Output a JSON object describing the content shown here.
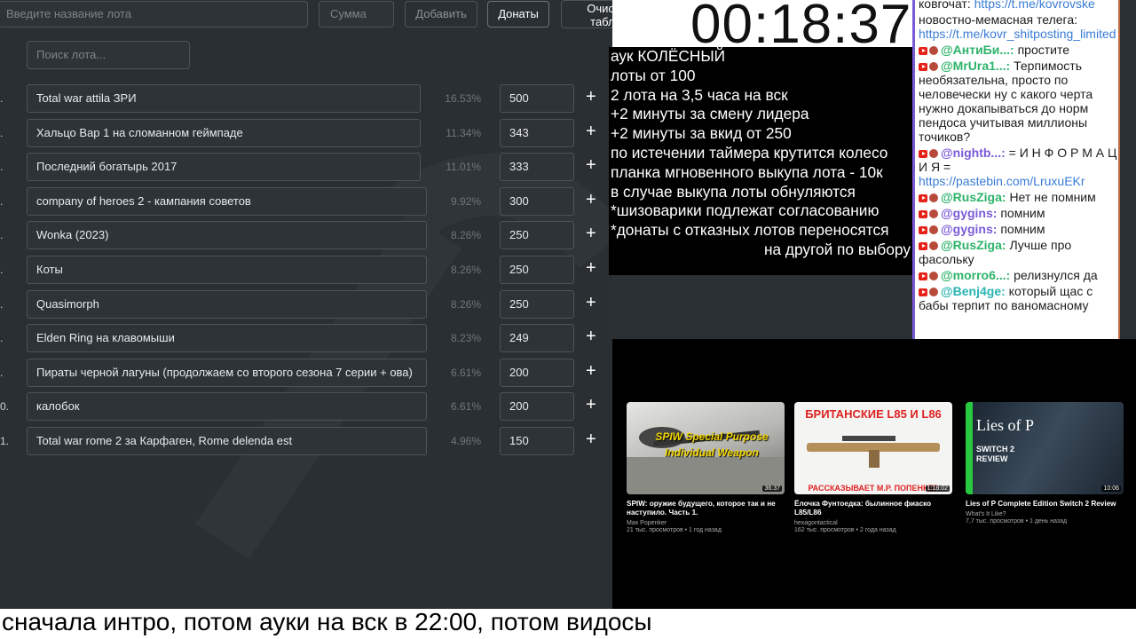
{
  "auction": {
    "lot_name_placeholder": "Введите название лота",
    "amount_placeholder": "Сумма",
    "add_label": "Добавить",
    "donations_label": "Донаты",
    "clear_label_line1": "Очистить",
    "clear_label_line2": "таблицу",
    "search_placeholder": "Поиск лота...",
    "lots": [
      {
        "num": ".",
        "name": "Total war attila ЗРИ",
        "percent": "16.53%",
        "amount": "500"
      },
      {
        "num": ".",
        "name": "Хальцо Вар 1 на сломанном геймпаде",
        "percent": "11.34%",
        "amount": "343"
      },
      {
        "num": ".",
        "name": "Последний богатырь 2017",
        "percent": "11.01%",
        "amount": "333"
      },
      {
        "num": ".",
        "name": "company of heroes 2 - кампания советов",
        "percent": "9.92%",
        "amount": "300"
      },
      {
        "num": ".",
        "name": "Wonka (2023)",
        "percent": "8.26%",
        "amount": "250"
      },
      {
        "num": ".",
        "name": "Коты",
        "percent": "8.26%",
        "amount": "250"
      },
      {
        "num": ".",
        "name": "Quasimorph",
        "percent": "8.26%",
        "amount": "250"
      },
      {
        "num": ".",
        "name": "Elden Ring на клавомыши",
        "percent": "8.23%",
        "amount": "249"
      },
      {
        "num": ".",
        "name": "Пираты черной лагуны (продолжаем со второго сезона 7 серии + ова)",
        "percent": "6.61%",
        "amount": "200"
      },
      {
        "num": "0.",
        "name": "калобок",
        "percent": "6.61%",
        "amount": "200"
      },
      {
        "num": "1.",
        "name": "Total war rome 2 за Карфаген, Rome delenda est",
        "percent": "4.96%",
        "amount": "150"
      }
    ]
  },
  "timer": {
    "value": "00:18:37"
  },
  "rules": [
    "аук КОЛЁСНЫЙ",
    "лоты от 100",
    "2 лота на 3,5 часа на вск",
    "+2 минуты за смену лидера",
    "+2 минуты за вкид от 250",
    "по истечении таймера крутится колесо",
    "планка мгновенного выкупа лота - 10к",
    "в случае выкупа лоты обнуляются",
    "*шизоварики подлежат согласованию",
    "*донаты с отказных лотов переносятся",
    "на другой по выбору"
  ],
  "chat": {
    "intro_text": "ковrочат: ",
    "intro_link": "https://t.me/kovrovske",
    "intro_text2": "новостно-мемасная телега:",
    "intro_link2": "https://t.me/kovr_shitposting_limited",
    "messages": [
      {
        "user": "@АнтиБи...:",
        "color": "#2db36a",
        "text": "простите"
      },
      {
        "user": "@MrUra1...:",
        "color": "#2db36a",
        "text": "Терпимость необязательна, просто по человечески ну с какого черта нужно докапываться до норм пендоса учитывая миллионы точиков?"
      },
      {
        "user": "@nightb...:",
        "color": "#7a5ad8",
        "text": "= И Н Ф О Р М А Ц И Я =",
        "link": "https://pastebin.com/LruxuEKr"
      },
      {
        "user": "@RusZiga:",
        "color": "#2db36a",
        "text": "Нет не помним"
      },
      {
        "user": "@gygins:",
        "color": "#7a5ad8",
        "text": "помним"
      },
      {
        "user": "@gygins:",
        "color": "#7a5ad8",
        "text": "помним"
      },
      {
        "user": "@RusZiga:",
        "color": "#2db36a",
        "text": "Лучше про фасольку"
      },
      {
        "user": "@morro6...:",
        "color": "#2db36a",
        "text": "релизнулся да"
      },
      {
        "user": "@Benj4ge:",
        "color": "#2bb3b3",
        "text": "который щас с бабы терпит по ваномасному"
      }
    ]
  },
  "videos": [
    {
      "thumb_text": "SPIW Special Purpose Individual Weapon",
      "duration": "36:37",
      "title": "SPIW: оружие будущего, которое так и не наступило. Часть 1.",
      "channel": "Max Popenker",
      "meta": "21 тыс. просмотров • 1 год назад"
    },
    {
      "thumb_text": "БРИТАНСКИЕ L85 И L86",
      "thumb_text2": "РАССКАЗЫВАЕТ М.Р. ПОПЕНКЕР",
      "duration": "1:18:02",
      "title": "Ёлочка Фунтоедка: былинное фиаско L85/L86",
      "channel": "hexagontactical",
      "meta": "162 тыс. просмотров • 2 года назад"
    },
    {
      "thumb_text": "Lies of P",
      "thumb_text2": "SWITCH 2 REVIEW",
      "duration": "10:06",
      "title": "Lies of P Complete Edition Switch 2 Review",
      "channel": "What's It Like?",
      "meta": "7,7 тыс. просмотров • 1 день назад"
    }
  ],
  "banner": {
    "text": "сначала интро, потом ауки на вск в 22:00, потом видосы"
  }
}
